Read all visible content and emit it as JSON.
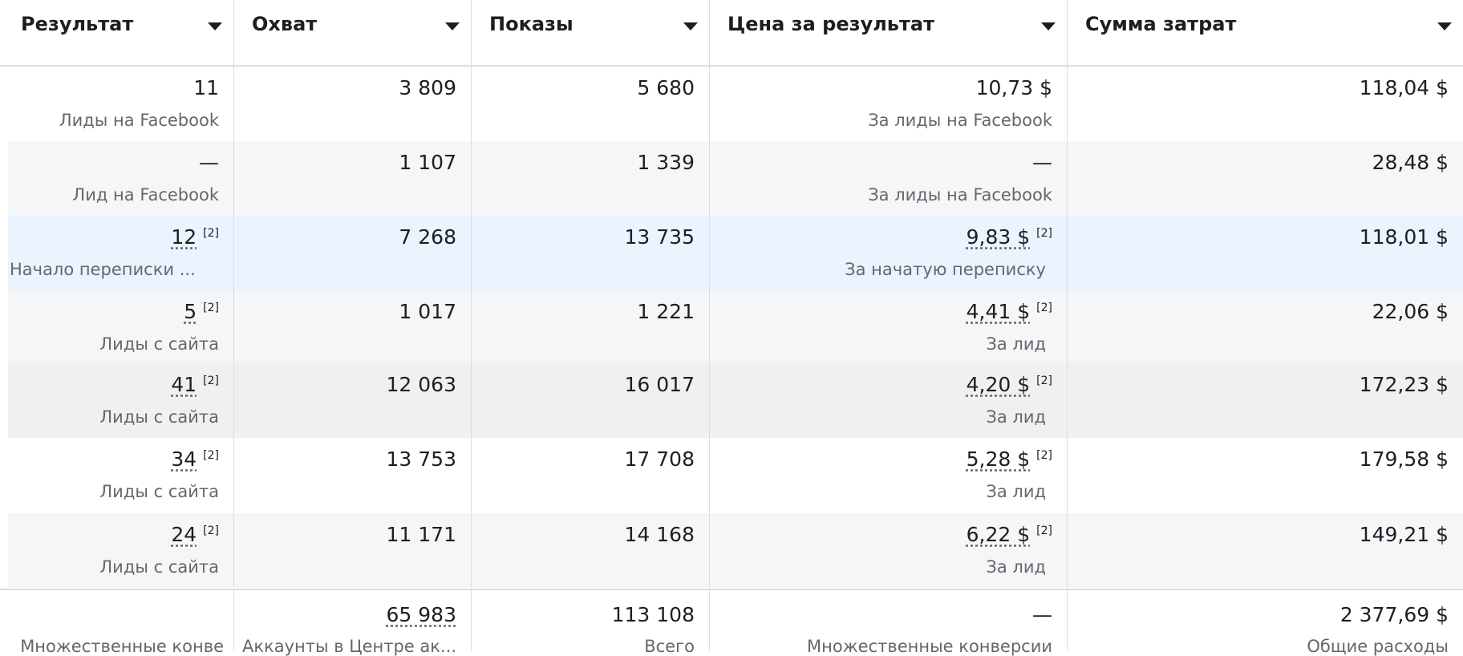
{
  "columns": [
    {
      "label": "Результат"
    },
    {
      "label": "Охват"
    },
    {
      "label": "Показы"
    },
    {
      "label": "Цена за результат"
    },
    {
      "label": "Сумма затрат"
    }
  ],
  "rows": [
    {
      "result": "11",
      "result_sup": "",
      "result_sub": "Лиды на Facebook",
      "reach": "3 809",
      "impressions": "5 680",
      "cost": "10,73 $",
      "cost_sup": "",
      "cost_sub": "За лиды на Facebook",
      "spend": "118,04 $",
      "bg": "#ffffff"
    },
    {
      "result": "—",
      "result_sup": "",
      "result_sub": "Лид на Facebook",
      "reach": "1 107",
      "impressions": "1 339",
      "cost": "—",
      "cost_sup": "",
      "cost_sub": "За лиды на Facebook",
      "spend": "28,48 $",
      "bg": "#f5f6f7"
    },
    {
      "result": "12",
      "result_sup": "[2]",
      "result_sub": "Начало переписки ...",
      "reach": "7 268",
      "impressions": "13 735",
      "cost": "9,83 $",
      "cost_sup": "[2]",
      "cost_sub": "За начатую переписку",
      "spend": "118,01 $",
      "bg": "#ebf3fe"
    },
    {
      "result": "5",
      "result_sup": "[2]",
      "result_sub": "Лиды с сайта",
      "reach": "1 017",
      "impressions": "1 221",
      "cost": "4,41 $",
      "cost_sup": "[2]",
      "cost_sub": "За лид",
      "spend": "22,06 $",
      "bg": "#f5f6f7"
    },
    {
      "result": "41",
      "result_sup": "[2]",
      "result_sub": "Лиды с сайта",
      "reach": "12 063",
      "impressions": "16 017",
      "cost": "4,20 $",
      "cost_sup": "[2]",
      "cost_sub": "За лид",
      "spend": "172,23 $",
      "bg": "#eff0f1"
    },
    {
      "result": "34",
      "result_sup": "[2]",
      "result_sub": "Лиды с сайта",
      "reach": "13 753",
      "impressions": "17 708",
      "cost": "5,28 $",
      "cost_sup": "[2]",
      "cost_sub": "За лид",
      "spend": "179,58 $",
      "bg": "#ffffff"
    },
    {
      "result": "24",
      "result_sup": "[2]",
      "result_sub": "Лиды с сайта",
      "reach": "11 171",
      "impressions": "14 168",
      "cost": "6,22 $",
      "cost_sup": "[2]",
      "cost_sub": "За лид",
      "spend": "149,21 $",
      "bg": "#f5f6f7"
    }
  ],
  "totals": {
    "result": "",
    "result_sub": "Множественные конве",
    "reach": "65 983",
    "reach_sub": "Аккаунты в Центре ак...",
    "impressions": "113 108",
    "impressions_sub": "Всего",
    "cost": "—",
    "cost_sub": "Множественные конверсии",
    "spend": "2 377,69 $",
    "spend_sub": "Общие расходы"
  },
  "colors": {
    "border": "#dadde1",
    "subtext": "#65676b",
    "highlight_row": "#ebf3fe"
  },
  "icons": {
    "sort": "caret-down-icon"
  }
}
